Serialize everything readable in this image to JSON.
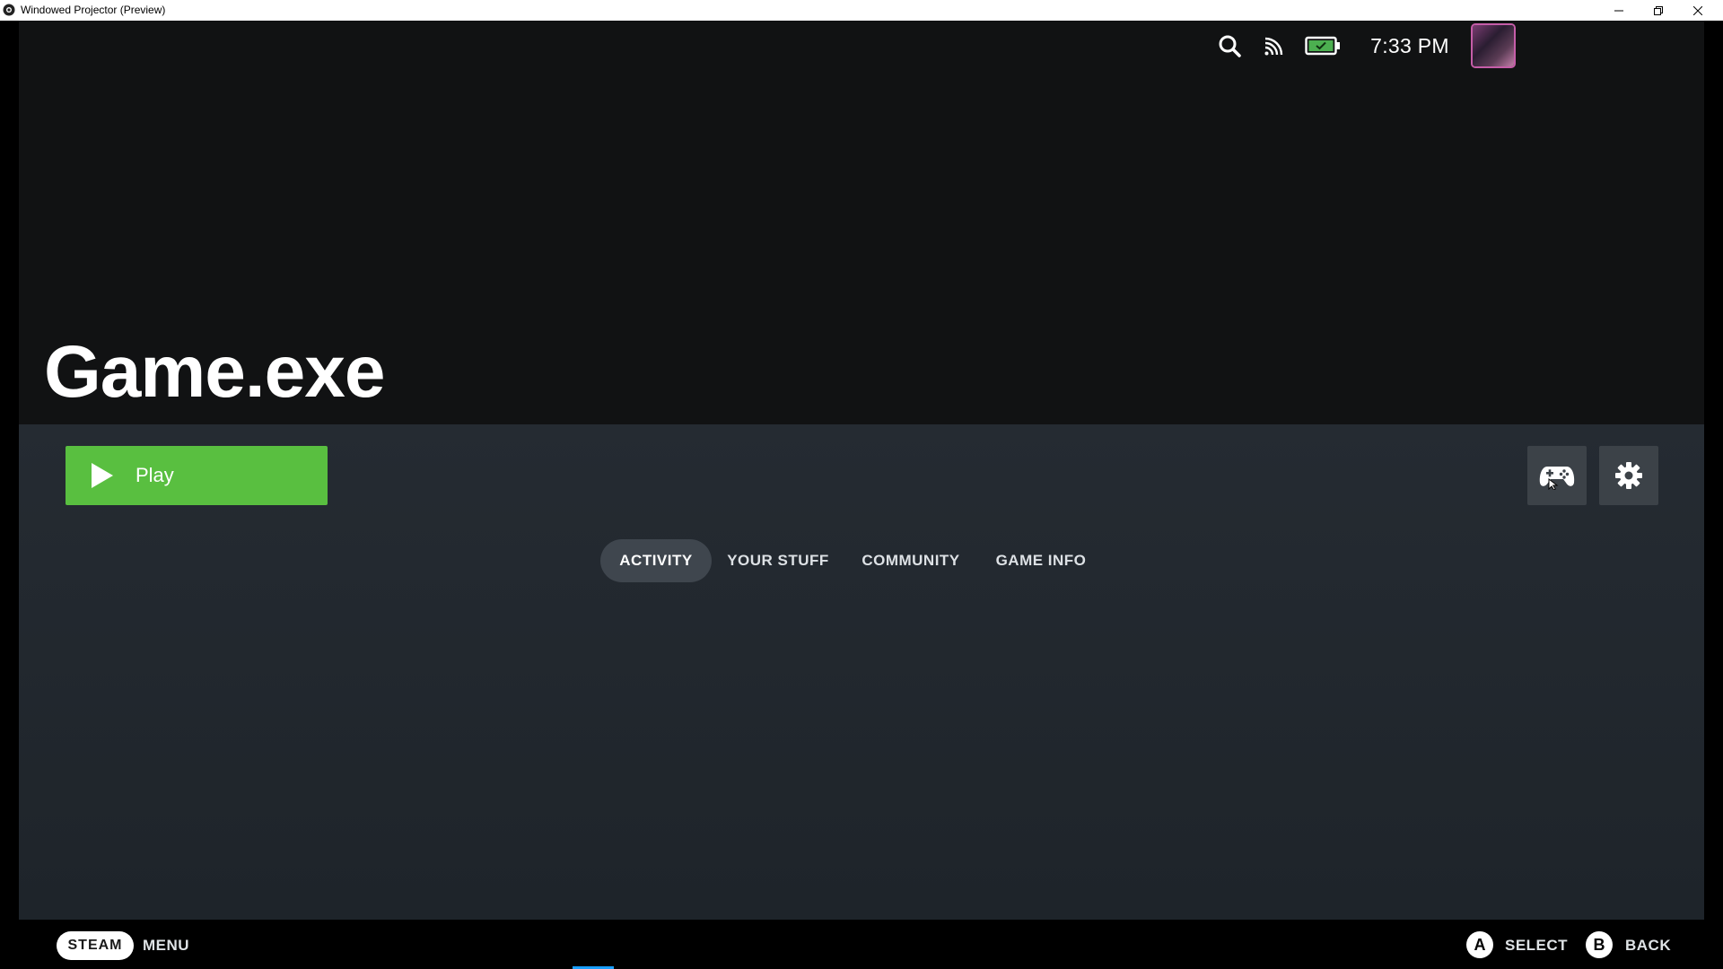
{
  "window": {
    "title": "Windowed Projector (Preview)",
    "controls": [
      "minimize-icon",
      "restore-icon",
      "close-icon"
    ]
  },
  "statusbar": {
    "icons": [
      "search-icon",
      "cast-icon",
      "battery-icon"
    ],
    "time": "7:33 PM",
    "battery_color": "#4caf50"
  },
  "game": {
    "title": "Game.exe"
  },
  "actions": {
    "play_label": "Play",
    "play_color": "#59bf40",
    "controller_icon": "controller-icon",
    "settings_icon": "gear-icon"
  },
  "tabs": [
    {
      "label": "ACTIVITY",
      "active": true
    },
    {
      "label": "YOUR STUFF",
      "active": false
    },
    {
      "label": "COMMUNITY",
      "active": false
    },
    {
      "label": "GAME INFO",
      "active": false
    }
  ],
  "hints": {
    "steam_label": "STEAM",
    "menu_label": "MENU",
    "a_glyph": "A",
    "select_label": "SELECT",
    "b_glyph": "B",
    "back_label": "BACK"
  }
}
